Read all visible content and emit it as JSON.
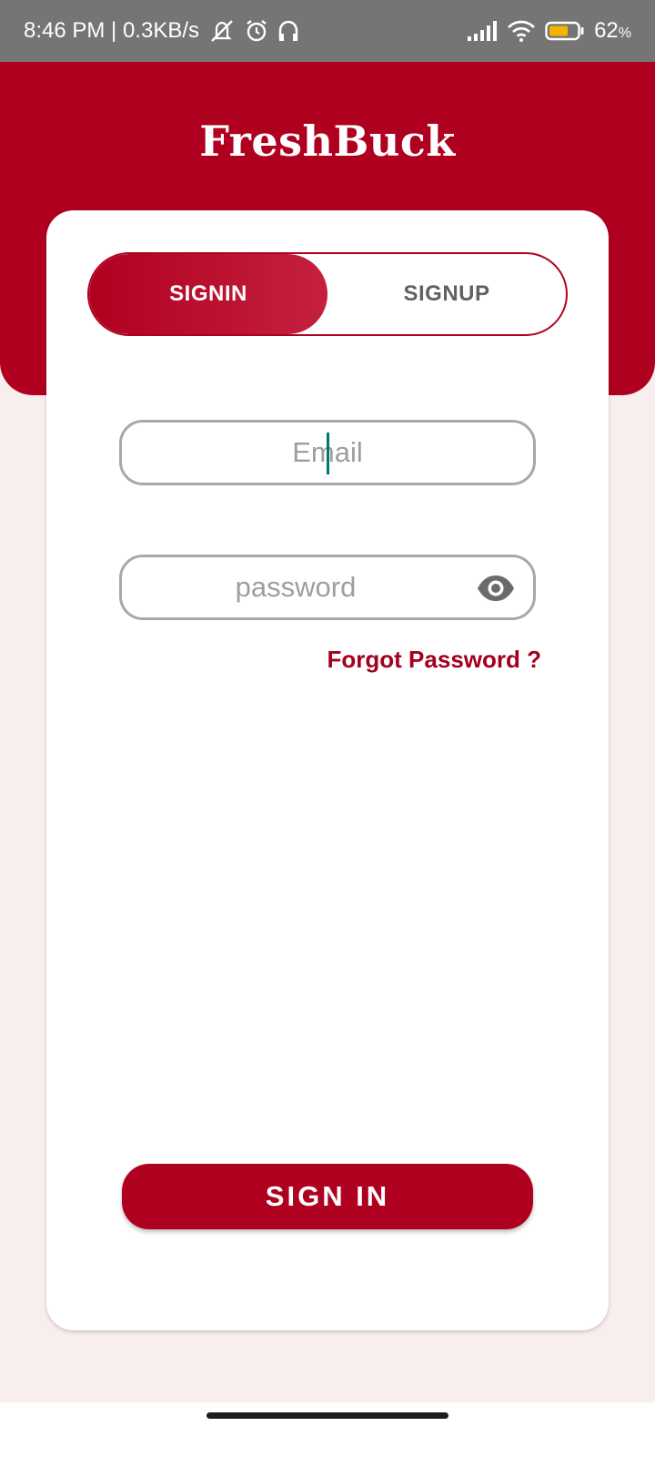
{
  "status_bar": {
    "time_speed": "8:46 PM | 0.3KB/s",
    "battery_percent": "62",
    "battery_suffix": "%",
    "icons": [
      "mute-icon",
      "alarm-icon",
      "headphones-icon",
      "signal-icon",
      "wifi-icon",
      "battery-icon"
    ]
  },
  "app": {
    "title": "FreshBuck"
  },
  "auth_tabs": {
    "signin": "SIGNIN",
    "signup": "SIGNUP",
    "active": "signin"
  },
  "form": {
    "email_placeholder": "Email",
    "password_placeholder": "password",
    "forgot_label": "Forgot Password ?",
    "submit_label": "SIGN IN"
  },
  "colors": {
    "brand": "#b00020",
    "background": "#f9eeee",
    "status_bar": "#757575",
    "cursor": "#00796b",
    "battery": "#f5b400"
  }
}
